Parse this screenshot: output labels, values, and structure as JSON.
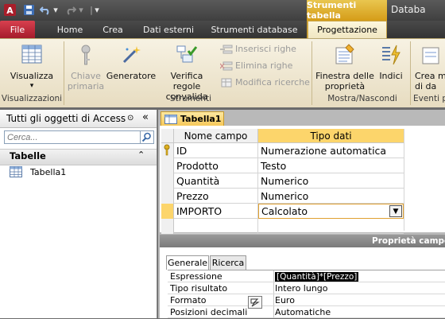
{
  "app": {
    "title": "Databa",
    "context_group": "Strumenti tabella"
  },
  "tabs": [
    "File",
    "Home",
    "Crea",
    "Dati esterni",
    "Strumenti database",
    "Progettazione"
  ],
  "ribbon": {
    "visualizza": "Visualizza",
    "group_views": "Visualizzazioni",
    "chiave_line1": "Chiave",
    "chiave_line2": "primaria",
    "generatore": "Generatore",
    "verifica_line1": "Verifica regole",
    "verifica_line2": "convalida",
    "inserisci": "Inserisci righe",
    "elimina": "Elimina righe",
    "modifica": "Modifica ricerche",
    "group_tools": "Strumenti",
    "finestra_line1": "Finestra delle",
    "finestra_line2": "proprietà",
    "indici": "Indici",
    "group_show": "Mostra/Nascondi",
    "crea_line1": "Crea m",
    "crea_line2": "di da",
    "group_events": "Eventi p"
  },
  "nav": {
    "title": "Tutti gli oggetti di Access",
    "search_placeholder": "Cerca...",
    "group": "Tabelle",
    "items": [
      "Tabella1"
    ]
  },
  "document": {
    "tab": "Tabella1",
    "columns": [
      "Nome campo",
      "Tipo dati"
    ],
    "rows": [
      {
        "name": "ID",
        "type": "Numerazione automatica",
        "key": true
      },
      {
        "name": "Prodotto",
        "type": "Testo"
      },
      {
        "name": "Quantità",
        "type": "Numerico"
      },
      {
        "name": "Prezzo",
        "type": "Numerico"
      },
      {
        "name": "IMPORTO",
        "type": "Calcolato",
        "selected": true
      }
    ]
  },
  "properties": {
    "title": "Proprietà campo",
    "tabs": [
      "Generale",
      "Ricerca"
    ],
    "rows": [
      {
        "label": "Espressione",
        "value": "[Quantità]*[Prezzo]"
      },
      {
        "label": "Tipo risultato",
        "value": "Intero lungo"
      },
      {
        "label": "Formato",
        "value": "Euro"
      },
      {
        "label": "Posizioni decimali",
        "value": "Automatiche"
      }
    ]
  },
  "colors": {
    "accent": "#f6c85a",
    "file_tab": "#c0283a",
    "selected_row": "#fcd56b"
  }
}
